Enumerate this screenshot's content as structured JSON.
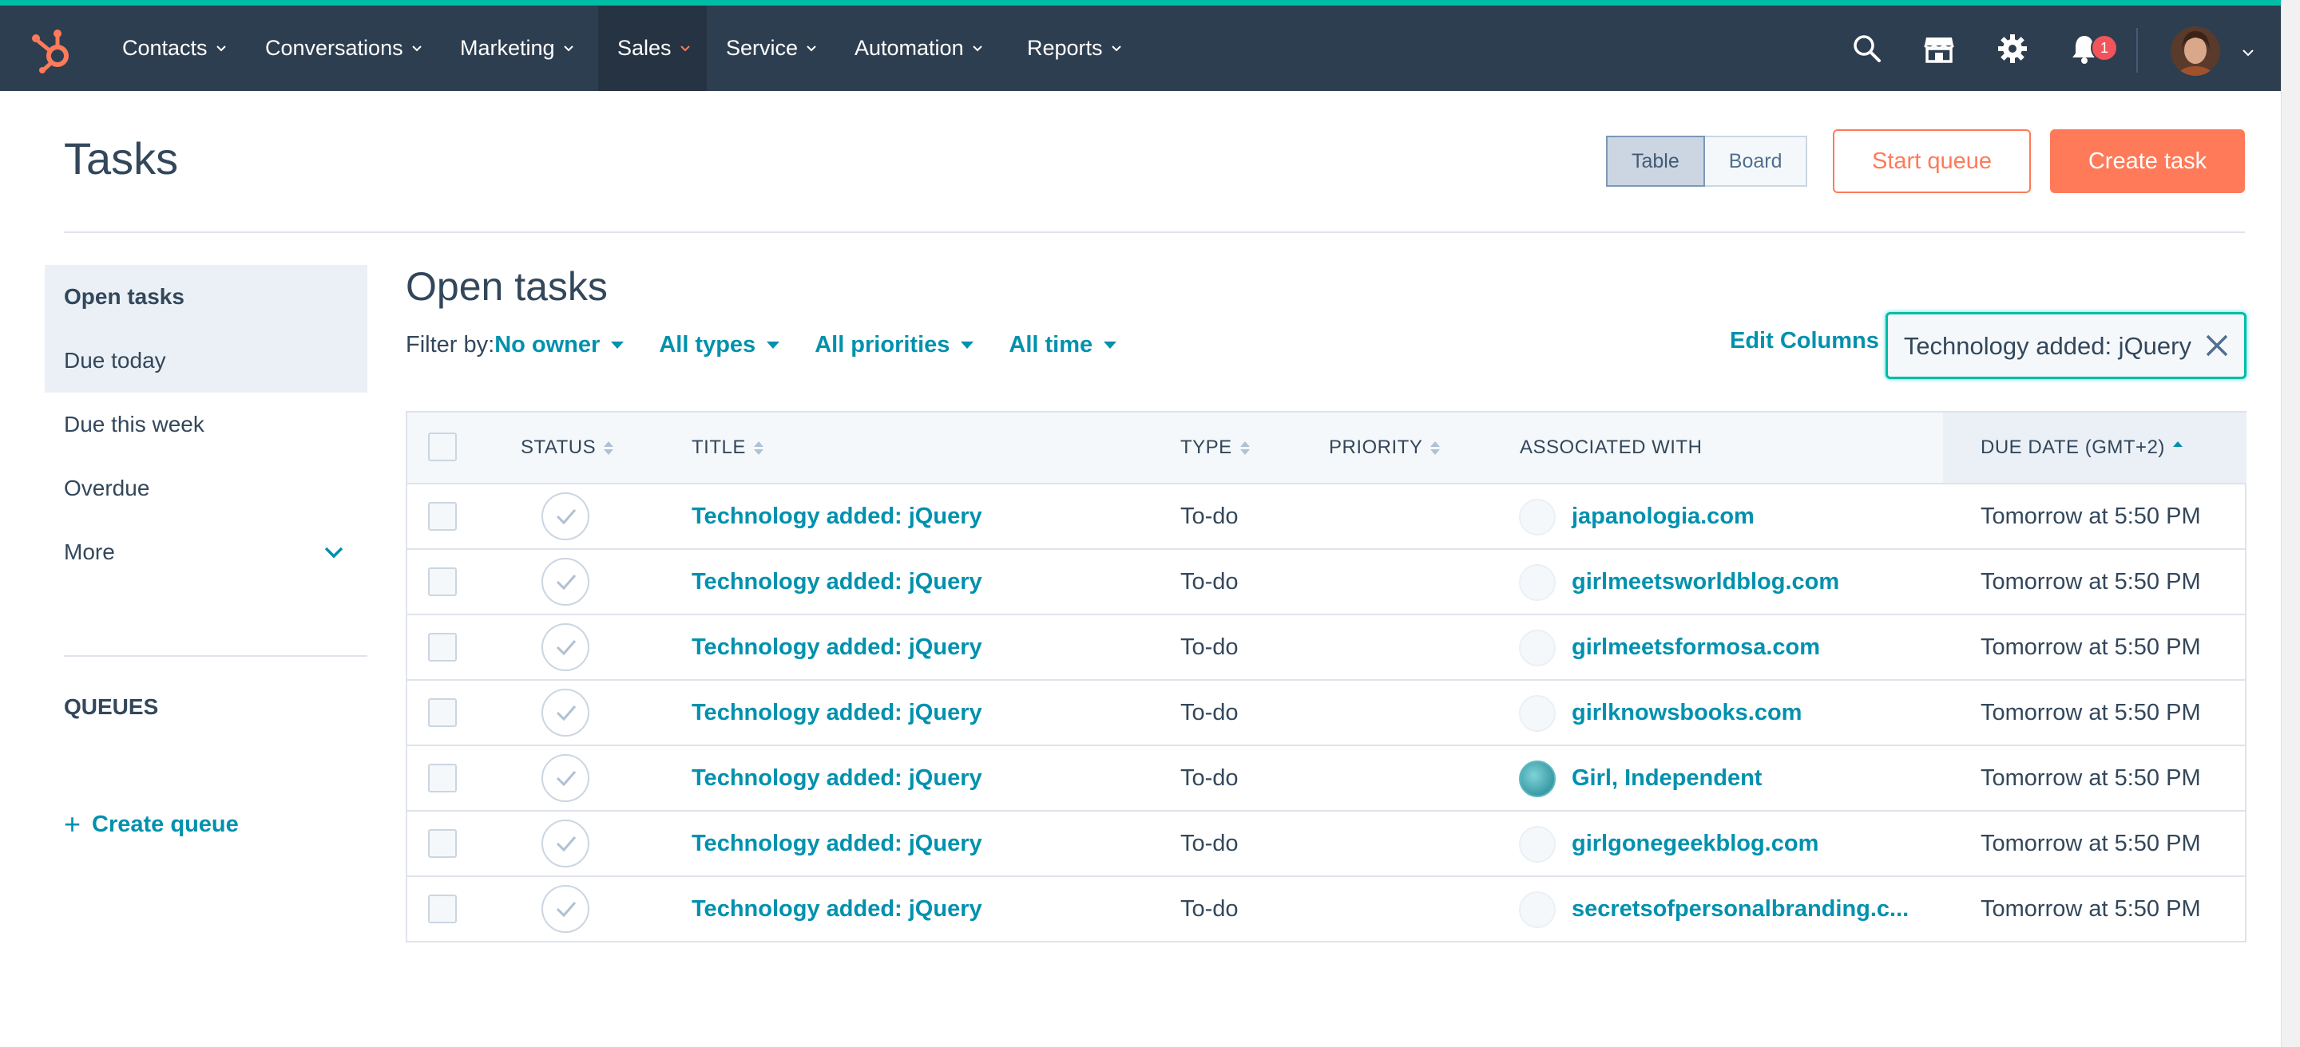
{
  "nav": {
    "items": [
      {
        "label": "Contacts"
      },
      {
        "label": "Conversations"
      },
      {
        "label": "Marketing"
      },
      {
        "label": "Sales"
      },
      {
        "label": "Service"
      },
      {
        "label": "Automation"
      },
      {
        "label": "Reports"
      }
    ],
    "active": "Sales",
    "notification_count": "1",
    "icons": [
      "hubspot-logo",
      "search-icon",
      "marketplace-icon",
      "gear-icon",
      "bell-icon",
      "avatar",
      "chevron-down-icon"
    ]
  },
  "header": {
    "title": "Tasks",
    "view_table": "Table",
    "view_board": "Board",
    "active_view": "Table",
    "start_queue": "Start queue",
    "create_task": "Create task"
  },
  "sidebar": {
    "items": [
      {
        "label": "Open tasks"
      },
      {
        "label": "Due today"
      },
      {
        "label": "Due this week"
      },
      {
        "label": "Overdue"
      },
      {
        "label": "More"
      }
    ],
    "queues_label": "QUEUES",
    "create_queue": "Create queue"
  },
  "main": {
    "section_title": "Open tasks",
    "filter_label": "Filter by:",
    "filters": [
      "No owner",
      "All types",
      "All priorities",
      "All time"
    ],
    "edit_columns": "Edit Columns",
    "search_value": "Technology added: jQuery"
  },
  "table": {
    "columns": [
      "STATUS",
      "TITLE",
      "TYPE",
      "PRIORITY",
      "ASSOCIATED WITH",
      "DUE DATE (GMT+2)"
    ],
    "sorted_column": "DUE DATE (GMT+2)",
    "rows": [
      {
        "title": "Technology added: jQuery",
        "type": "To-do",
        "priority": "",
        "associated": "japanologia.com",
        "due": "Tomorrow at 5:50 PM"
      },
      {
        "title": "Technology added: jQuery",
        "type": "To-do",
        "priority": "",
        "associated": "girlmeetsworldblog.com",
        "due": "Tomorrow at 5:50 PM"
      },
      {
        "title": "Technology added: jQuery",
        "type": "To-do",
        "priority": "",
        "associated": "girlmeetsformosa.com",
        "due": "Tomorrow at 5:50 PM"
      },
      {
        "title": "Technology added: jQuery",
        "type": "To-do",
        "priority": "",
        "associated": "girlknowsbooks.com",
        "due": "Tomorrow at 5:50 PM"
      },
      {
        "title": "Technology added: jQuery",
        "type": "To-do",
        "priority": "",
        "associated": "Girl, Independent",
        "due": "Tomorrow at 5:50 PM"
      },
      {
        "title": "Technology added: jQuery",
        "type": "To-do",
        "priority": "",
        "associated": "girlgonegeekblog.com",
        "due": "Tomorrow at 5:50 PM"
      },
      {
        "title": "Technology added: jQuery",
        "type": "To-do",
        "priority": "",
        "associated": "secretsofpersonalbranding.c...",
        "due": "Tomorrow at 5:50 PM"
      }
    ]
  },
  "colors": {
    "nav_bg": "#2d3e50",
    "accent_teal": "#00bda5",
    "primary_orange": "#ff7a59",
    "link": "#0091ae",
    "text": "#33475b"
  }
}
